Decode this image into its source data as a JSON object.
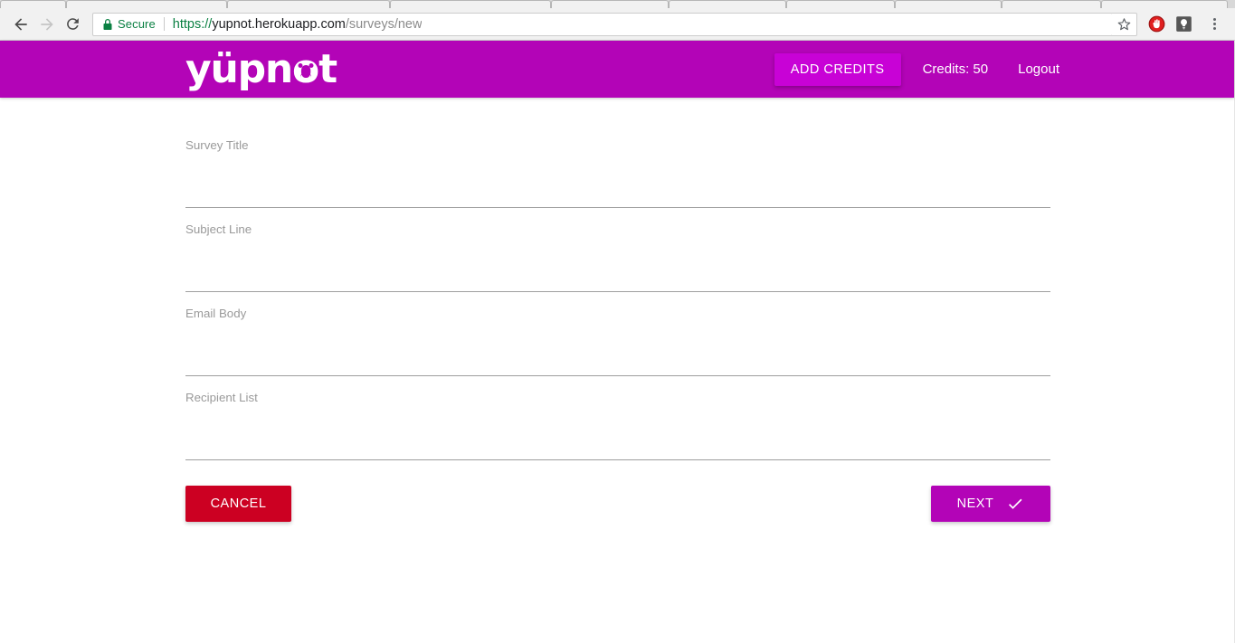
{
  "browser": {
    "nav": {
      "back": "back-arrow",
      "forward": "forward-arrow",
      "reload": "reload"
    },
    "omnibox": {
      "security_icon": "lock-icon",
      "security_label": "Secure",
      "url_scheme": "https://",
      "url_host": "yupnot.herokuapp.com",
      "url_path": "/surveys/new",
      "full_url": "https://yupnot.herokuapp.com/surveys/new"
    },
    "bookmark_icon": "star-icon",
    "extensions": [
      {
        "name": "adblock-stop-hand-icon"
      },
      {
        "name": "lightbulb-icon"
      }
    ],
    "menu_icon": "three-dot-menu-icon"
  },
  "header": {
    "brand": {
      "prefix": "yüpn",
      "face_letter": "o",
      "suffix": "t",
      "full": "yüpnot"
    },
    "add_credits_label": "ADD CREDITS",
    "credits_label": "Credits: 50",
    "logout_label": "Logout",
    "colors": {
      "header_bg": "#b304b7",
      "add_credits_bg": "#c802d6",
      "text": "#ffffff"
    }
  },
  "form": {
    "fields": [
      {
        "label": "Survey Title",
        "value": "",
        "placeholder": ""
      },
      {
        "label": "Subject Line",
        "value": "",
        "placeholder": ""
      },
      {
        "label": "Email Body",
        "value": "",
        "placeholder": ""
      },
      {
        "label": "Recipient List",
        "value": "",
        "placeholder": ""
      }
    ],
    "cancel_label": "CANCEL",
    "next_label": "NEXT",
    "next_icon": "check-icon",
    "colors": {
      "cancel_bg": "#cc0022",
      "next_bg": "#b304b7",
      "label_text": "#9a9a9a",
      "underline": "#9e9e9e"
    }
  }
}
